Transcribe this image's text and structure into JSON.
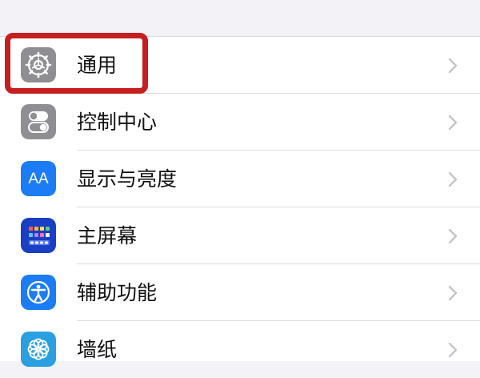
{
  "settings": {
    "items": [
      {
        "label": "通用",
        "icon": "gear-icon",
        "tile_color": "#8e8e93"
      },
      {
        "label": "控制中心",
        "icon": "toggles-icon",
        "tile_color": "#8e8e93"
      },
      {
        "label": "显示与亮度",
        "icon": "text-size-icon",
        "icon_text": "AA",
        "tile_color": "#1c7cf4"
      },
      {
        "label": "主屏幕",
        "icon": "home-grid-icon",
        "tile_color": "#1a3ec4"
      },
      {
        "label": "辅助功能",
        "icon": "accessibility-icon",
        "tile_color": "#1c7cf4"
      },
      {
        "label": "墙纸",
        "icon": "flower-icon",
        "tile_color": "#2aa0e0"
      }
    ]
  },
  "annotation": {
    "color": "#c61f1f"
  }
}
